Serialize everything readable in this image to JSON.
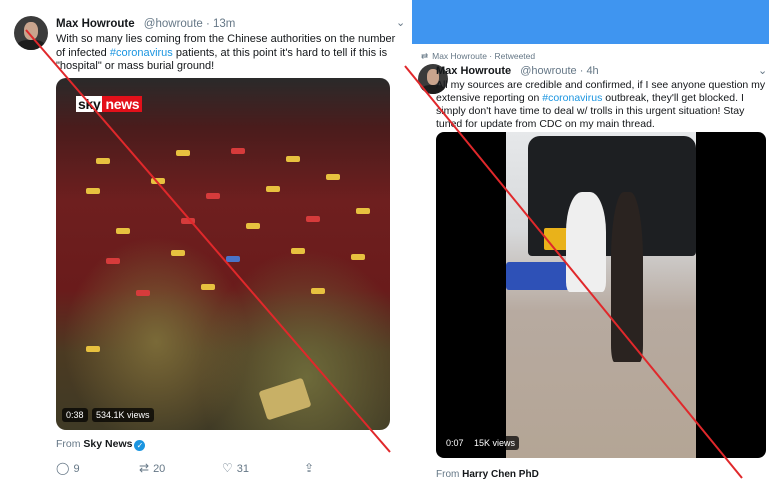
{
  "colors": {
    "accent_blue": "#1b95e0",
    "band_blue": "#3f95f0",
    "strike_red": "#e0282b"
  },
  "left_tweet": {
    "display_name": "Max Howroute",
    "handle_time": "@howroute · 13m",
    "text_before": "With so many lies coming from the Chinese authorities on the number of infected ",
    "hashtag": "#coronavirus",
    "text_after": " patients, at this point it's hard to tell if this is \"hospital\" or mass burial ground!",
    "menu_icon": "chevron-down-icon",
    "media": {
      "logo_sky": "sky",
      "logo_news": "news",
      "duration": "0:38",
      "views": "534.1K views"
    },
    "from_prefix": "From ",
    "from_source": "Sky News",
    "verified_icon": "✓",
    "actions": {
      "replies": "9",
      "retweets": "20",
      "likes": "31"
    }
  },
  "right_tweet": {
    "retweet_label": "Max Howroute · Retweeted",
    "display_name": "Max Howroute",
    "handle_time": "@howroute · 4h",
    "text_before": "All my sources are credible and confirmed, if I see anyone question my extensive reporting on ",
    "hashtag": "#coronavirus",
    "text_after": " outbreak, they'll get blocked. I simply don't have time to deal w/ trolls in this urgent situation! Stay tuned for update from CDC on my main thread.",
    "menu_icon": "chevron-down-icon",
    "media": {
      "duration": "0:07",
      "views": "15K views"
    },
    "from_prefix": "From ",
    "from_source": "Harry Chen PhD"
  }
}
